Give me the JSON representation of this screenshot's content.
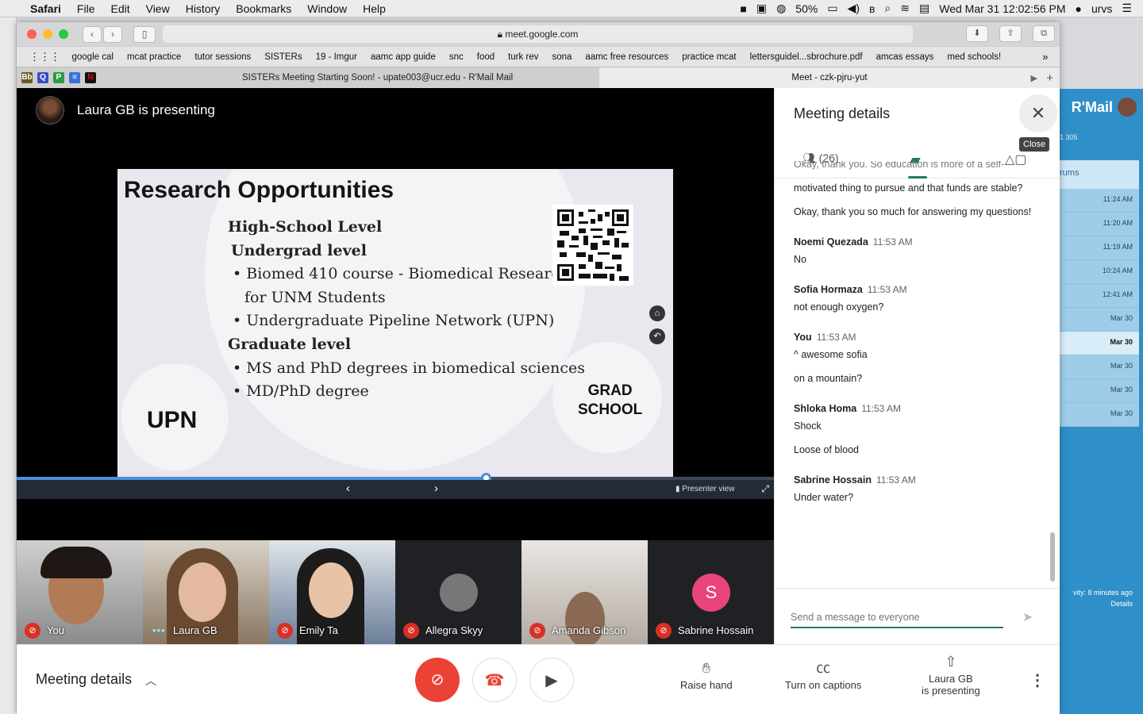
{
  "menubar": {
    "app": "Safari",
    "items": [
      "File",
      "Edit",
      "View",
      "History",
      "Bookmarks",
      "Window",
      "Help"
    ],
    "battery": "50%",
    "datetime": "Wed Mar 31  12:02:56 PM",
    "user": "urvs"
  },
  "browser": {
    "url": "meet.google.com",
    "bookmarks": [
      "google cal",
      "mcat practice",
      "tutor sessions",
      "SISTERs",
      "19 - Imgur",
      "aamc app guide",
      "snc",
      "food",
      "turk rev",
      "sona",
      "aamc free resources",
      "practice mcat",
      "lettersguidel...sbrochure.pdf",
      "amcas essays",
      "med schools!"
    ],
    "tabs": {
      "tab1": "SISTERs Meeting Starting Soon! - upate003@ucr.edu - R'Mail Mail",
      "tab2": "Meet - czk-pjru-yut"
    }
  },
  "background_window": {
    "counter": "1 305",
    "rums_label": "rums",
    "times": [
      "11:24 AM",
      "11:20 AM",
      "11:19 AM",
      "10:24 AM",
      "12:41 AM",
      "Mar 30",
      "Mar 30",
      "Mar 30",
      "Mar 30",
      "Mar 30"
    ],
    "footer1": "vity: 8 minutes ago",
    "footer2": "Details"
  },
  "stage": {
    "presenter": "Laura GB is presenting",
    "presenter_view": "Presenter view",
    "progress": 0.62
  },
  "slide": {
    "title": "Research Opportunities",
    "lines": [
      "High-School Level",
      "Undergrad level",
      "• Biomed 410 course - Biomedical Research",
      "for UNM Students",
      "• Undergraduate Pipeline Network (UPN)",
      "Graduate level",
      "• MS and PhD degrees in biomedical sciences",
      "• MD/PhD degree"
    ],
    "upn": "UPN",
    "grad1": "GRAD",
    "grad2": "SCHOOL"
  },
  "participants": [
    "You",
    "Laura GB",
    "Emily Ta",
    "Allegra Skyy",
    "Amanda Gibson",
    "Sabrine Hossain"
  ],
  "sabrine_initial": "S",
  "bottom": {
    "meeting_details": "Meeting details",
    "raise_hand": "Raise hand",
    "captions": "Turn on captions",
    "presenting1": "Laura GB",
    "presenting2": "is presenting"
  },
  "panel": {
    "title": "Meeting details",
    "close_tip": "Close",
    "people_count": "(26)",
    "partial": "Okay, thank you. So education is more of a self-",
    "m0": "motivated thing to pursue and that funds are stable?",
    "m0b": "Okay, thank you so much for answering my questions!",
    "messages": [
      {
        "who": "Noemi Quezada",
        "ts": "11:53 AM",
        "lines": [
          "No"
        ]
      },
      {
        "who": "Sofia Hormaza",
        "ts": "11:53 AM",
        "lines": [
          "not enough oxygen?"
        ]
      },
      {
        "who": "You",
        "ts": "11:53 AM",
        "lines": [
          "^ awesome sofia",
          "on a mountain?"
        ]
      },
      {
        "who": "Shloka Homa",
        "ts": "11:53 AM",
        "lines": [
          "Shock",
          "Loose of blood"
        ]
      },
      {
        "who": "Sabrine Hossain",
        "ts": "11:53 AM",
        "lines": [
          "Under water?"
        ]
      }
    ],
    "input_placeholder": "Send a message to everyone"
  }
}
